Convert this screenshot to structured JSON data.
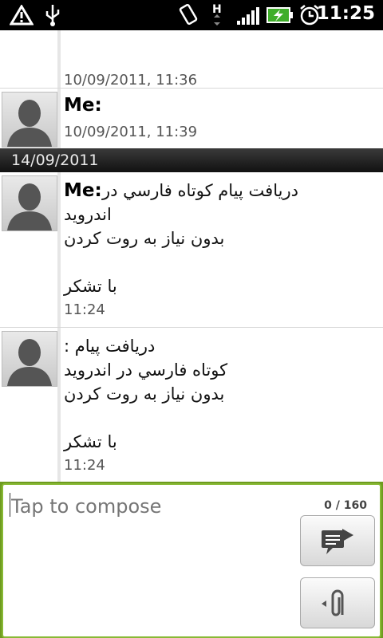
{
  "status_bar": {
    "time": "11:25",
    "icons": [
      "warning-icon",
      "usb-icon",
      "vibrate-icon",
      "hspa-data-icon",
      "signal-icon",
      "battery-charging-icon",
      "alarm-icon"
    ]
  },
  "messages": [
    {
      "sender": "",
      "lines": [],
      "timestamp": "10/09/2011, 11:36"
    },
    {
      "sender": "Me:",
      "lines": [],
      "timestamp": "10/09/2011, 11:39"
    },
    {
      "date_separator": "14/09/2011"
    },
    {
      "sender": "Me:",
      "lines": [
        "دريافت پيام کوتاه فارسي در",
        "اندرويد",
        "بدون نياز به روت کردن",
        "",
        "با تشکر"
      ],
      "timestamp": "11:24"
    },
    {
      "sender": "",
      "lines": [
        "دريافت پيام :",
        "کوتاه فارسي در اندرويد",
        "بدون نياز به روت کردن",
        "",
        "با تشکر"
      ],
      "timestamp": "11:24"
    }
  ],
  "compose": {
    "placeholder": "Tap to compose",
    "counter": "0 / 160"
  },
  "colors": {
    "compose_border": "#88b935",
    "date_separator_bg": "#1a1a1a"
  }
}
